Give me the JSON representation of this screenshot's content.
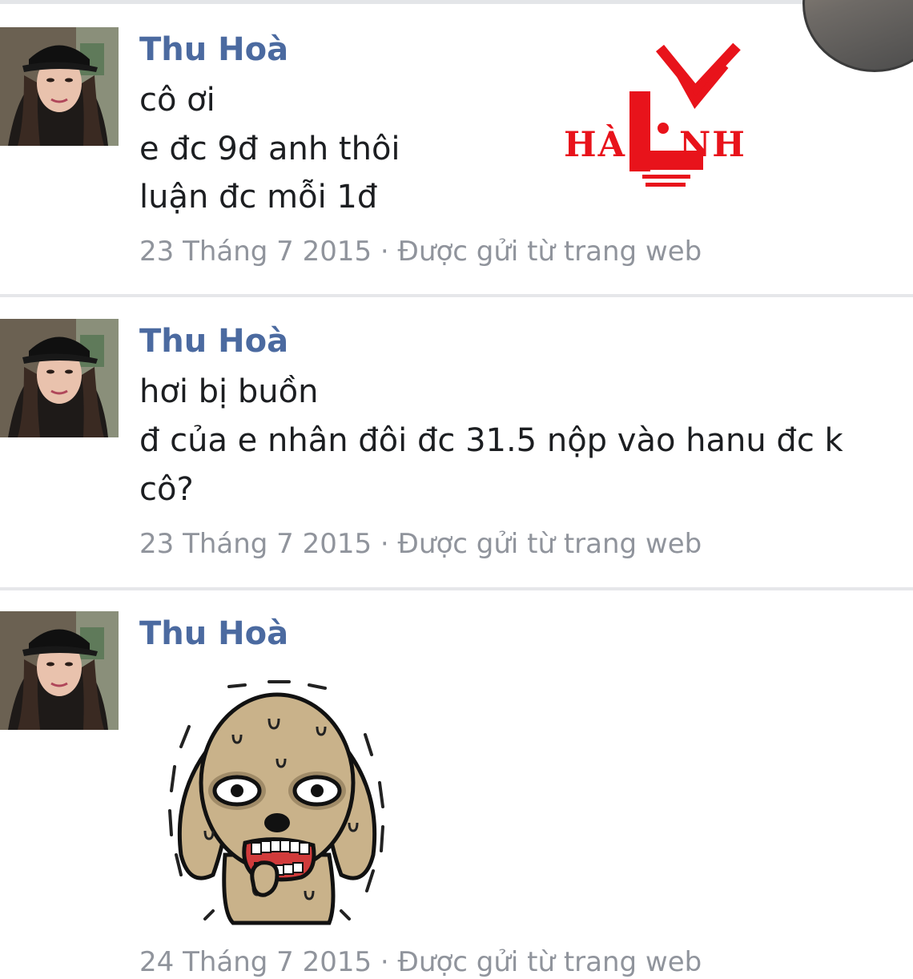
{
  "messages": [
    {
      "sender": "Thu Hoà",
      "lines": [
        "cô ơi",
        "e đc 9đ anh thôi",
        "luận đc mỗi 1đ"
      ],
      "meta": "23 Tháng 7 2015 · Được gửi từ trang web"
    },
    {
      "sender": "Thu Hoà",
      "lines": [
        "hơi bị buồn",
        "đ của e nhân đôi đc 31.5 nộp vào hanu đc k",
        "cô?"
      ],
      "meta": "23 Tháng 7 2015 · Được gửi từ trang web"
    },
    {
      "sender": "Thu Hoà",
      "sticker": "nervous-sweating-dog-sticker",
      "meta": "24 Tháng 7 2015 · Được gửi từ trang web"
    }
  ],
  "watermark": {
    "text_left": "HÀ",
    "text_right": "NH",
    "color": "#e8131b"
  },
  "colors": {
    "sender": "#4b6aa0",
    "text": "#1c1e21",
    "meta": "#90949c",
    "divider": "#e6e7ea"
  }
}
